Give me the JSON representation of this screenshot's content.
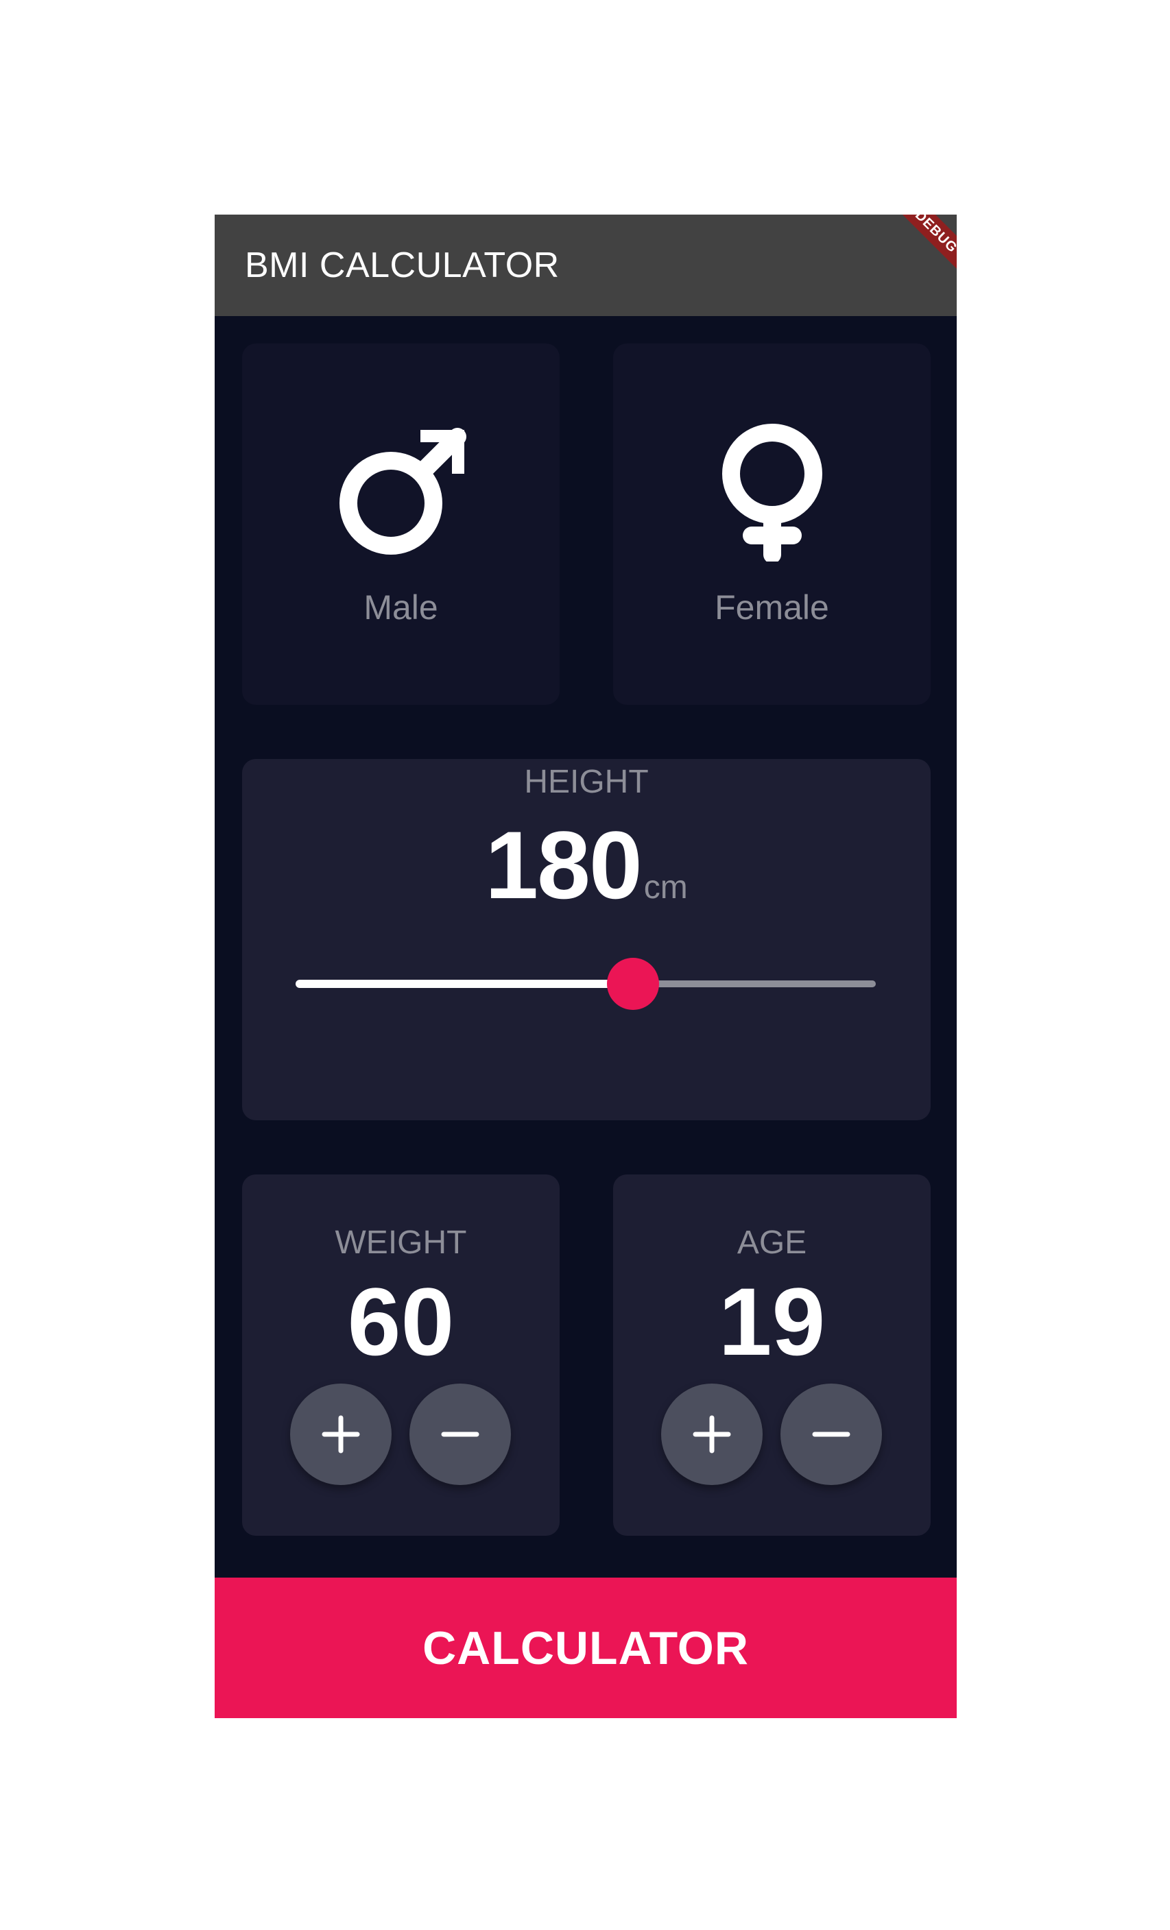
{
  "appbar": {
    "title": "BMI CALCULATOR",
    "debug_banner": "DEBUG"
  },
  "gender": {
    "male": {
      "label": "Male",
      "icon": "male-symbol-icon"
    },
    "female": {
      "label": "Female",
      "icon": "female-symbol-icon"
    }
  },
  "height": {
    "label": "HEIGHT",
    "value": "180",
    "unit": "cm",
    "slider_fraction": 0.5814
  },
  "weight": {
    "label": "WEIGHT",
    "value": "60"
  },
  "age": {
    "label": "AGE",
    "value": "19"
  },
  "footer": {
    "button_label": "CALCULATOR"
  },
  "colors": {
    "background": "#0a0e21",
    "active_card": "#1d1e33",
    "inactive_card": "#111328",
    "accent": "#eb1555",
    "label": "#8d8e98",
    "appbar": "#424242",
    "round_button": "#4c4f5e"
  }
}
